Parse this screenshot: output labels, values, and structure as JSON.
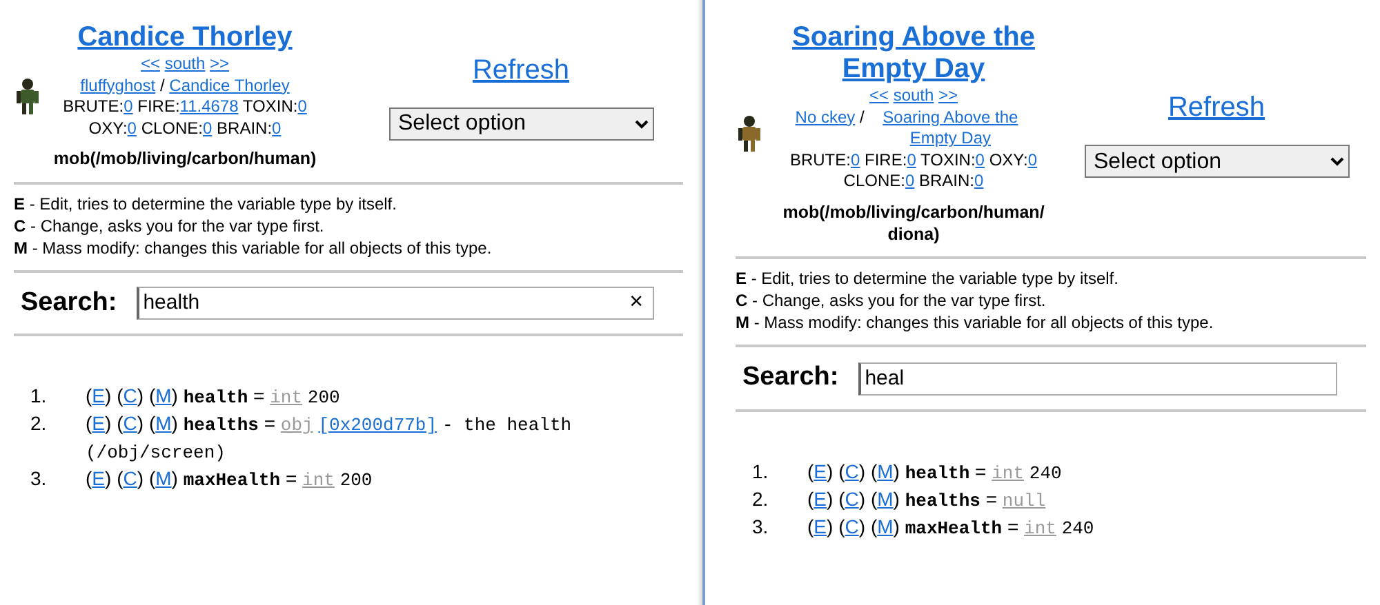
{
  "panels": [
    {
      "title": "Candice Thorley",
      "color": "#3c5a2a",
      "nav": {
        "prev": "<<",
        "dir": "south",
        "next": ">>"
      },
      "ckey": "fluffyghost",
      "sep": "/",
      "name_link": "Candice Thorley",
      "stats": [
        {
          "label": "BRUTE:",
          "value": "0"
        },
        {
          "label": "FIRE:",
          "value": "11.4678"
        },
        {
          "label": "TOXIN:",
          "value": "0"
        },
        {
          "label": "OXY:",
          "value": "0"
        },
        {
          "label": "CLONE:",
          "value": "0"
        },
        {
          "label": "BRAIN:",
          "value": "0"
        }
      ],
      "type_path": "mob(/mob/living/carbon/human)",
      "refresh": "Refresh",
      "select": "Select option",
      "help": [
        {
          "key": "E",
          "text": " - Edit, tries to determine the variable type by itself."
        },
        {
          "key": "C",
          "text": " - Change, asks you for the var type first."
        },
        {
          "key": "M",
          "text": " - Mass modify: changes this variable for all objects of this type."
        }
      ],
      "search": {
        "label": "Search:",
        "value": "health",
        "clear": "×"
      },
      "vars": [
        {
          "number": "1.",
          "links": [
            {
              "pre": "(",
              "key": "E",
              "post": ")"
            },
            {
              "pre": "(",
              "key": "C",
              "post": ")"
            },
            {
              "pre": "(",
              "key": "M",
              "post": ")"
            }
          ],
          "name": "health",
          "eq": "=",
          "type": "int",
          "value": "200"
        },
        {
          "number": "2.",
          "links": [
            {
              "pre": "(",
              "key": "E",
              "post": ")"
            },
            {
              "pre": "(",
              "key": "C",
              "post": ")"
            },
            {
              "pre": "(",
              "key": "M",
              "post": ")"
            }
          ],
          "name": "healths",
          "eq": "=",
          "type": "obj",
          "ref": "[0x200d77b]",
          "desc": "- the health",
          "ref_type": "(/obj/screen)"
        },
        {
          "number": "3.",
          "links": [
            {
              "pre": "(",
              "key": "E",
              "post": ")"
            },
            {
              "pre": "(",
              "key": "C",
              "post": ")"
            },
            {
              "pre": "(",
              "key": "M",
              "post": ")"
            }
          ],
          "name": "maxHealth",
          "eq": "=",
          "type": "int",
          "value": "200"
        }
      ]
    },
    {
      "title": "Soaring Above the Empty Day",
      "color": "#8a6a2a",
      "nav": {
        "prev": "<<",
        "dir": "south",
        "next": ">>"
      },
      "ckey": "No ckey",
      "sep": "/",
      "name_link": "Soaring Above the Empty Day",
      "stats": [
        {
          "label": "BRUTE:",
          "value": "0"
        },
        {
          "label": "FIRE:",
          "value": "0"
        },
        {
          "label": "TOXIN:",
          "value": "0"
        },
        {
          "label": "OXY:",
          "value": "0"
        },
        {
          "label": "CLONE:",
          "value": "0"
        },
        {
          "label": "BRAIN:",
          "value": "0"
        }
      ],
      "type_path": "mob(/mob/living/carbon/human/ diona)",
      "refresh": "Refresh",
      "select": "Select option",
      "help": [
        {
          "key": "E",
          "text": " - Edit, tries to determine the variable type by itself."
        },
        {
          "key": "C",
          "text": " - Change, asks you for the var type first."
        },
        {
          "key": "M",
          "text": " - Mass modify: changes this variable for all objects of this type."
        }
      ],
      "search": {
        "label": "Search:",
        "value": "heal"
      },
      "vars": [
        {
          "number": "1.",
          "links": [
            {
              "pre": "(",
              "key": "E",
              "post": ")"
            },
            {
              "pre": "(",
              "key": "C",
              "post": ")"
            },
            {
              "pre": "(",
              "key": "M",
              "post": ")"
            }
          ],
          "name": "health",
          "eq": "=",
          "type": "int",
          "value": "240"
        },
        {
          "number": "2.",
          "links": [
            {
              "pre": "(",
              "key": "E",
              "post": ")"
            },
            {
              "pre": "(",
              "key": "C",
              "post": ")"
            },
            {
              "pre": "(",
              "key": "M",
              "post": ")"
            }
          ],
          "name": "healths",
          "eq": "=",
          "type": "null"
        },
        {
          "number": "3.",
          "links": [
            {
              "pre": "(",
              "key": "E",
              "post": ")"
            },
            {
              "pre": "(",
              "key": "C",
              "post": ")"
            },
            {
              "pre": "(",
              "key": "M",
              "post": ")"
            }
          ],
          "name": "maxHealth",
          "eq": "=",
          "type": "int",
          "value": "240"
        }
      ]
    }
  ]
}
